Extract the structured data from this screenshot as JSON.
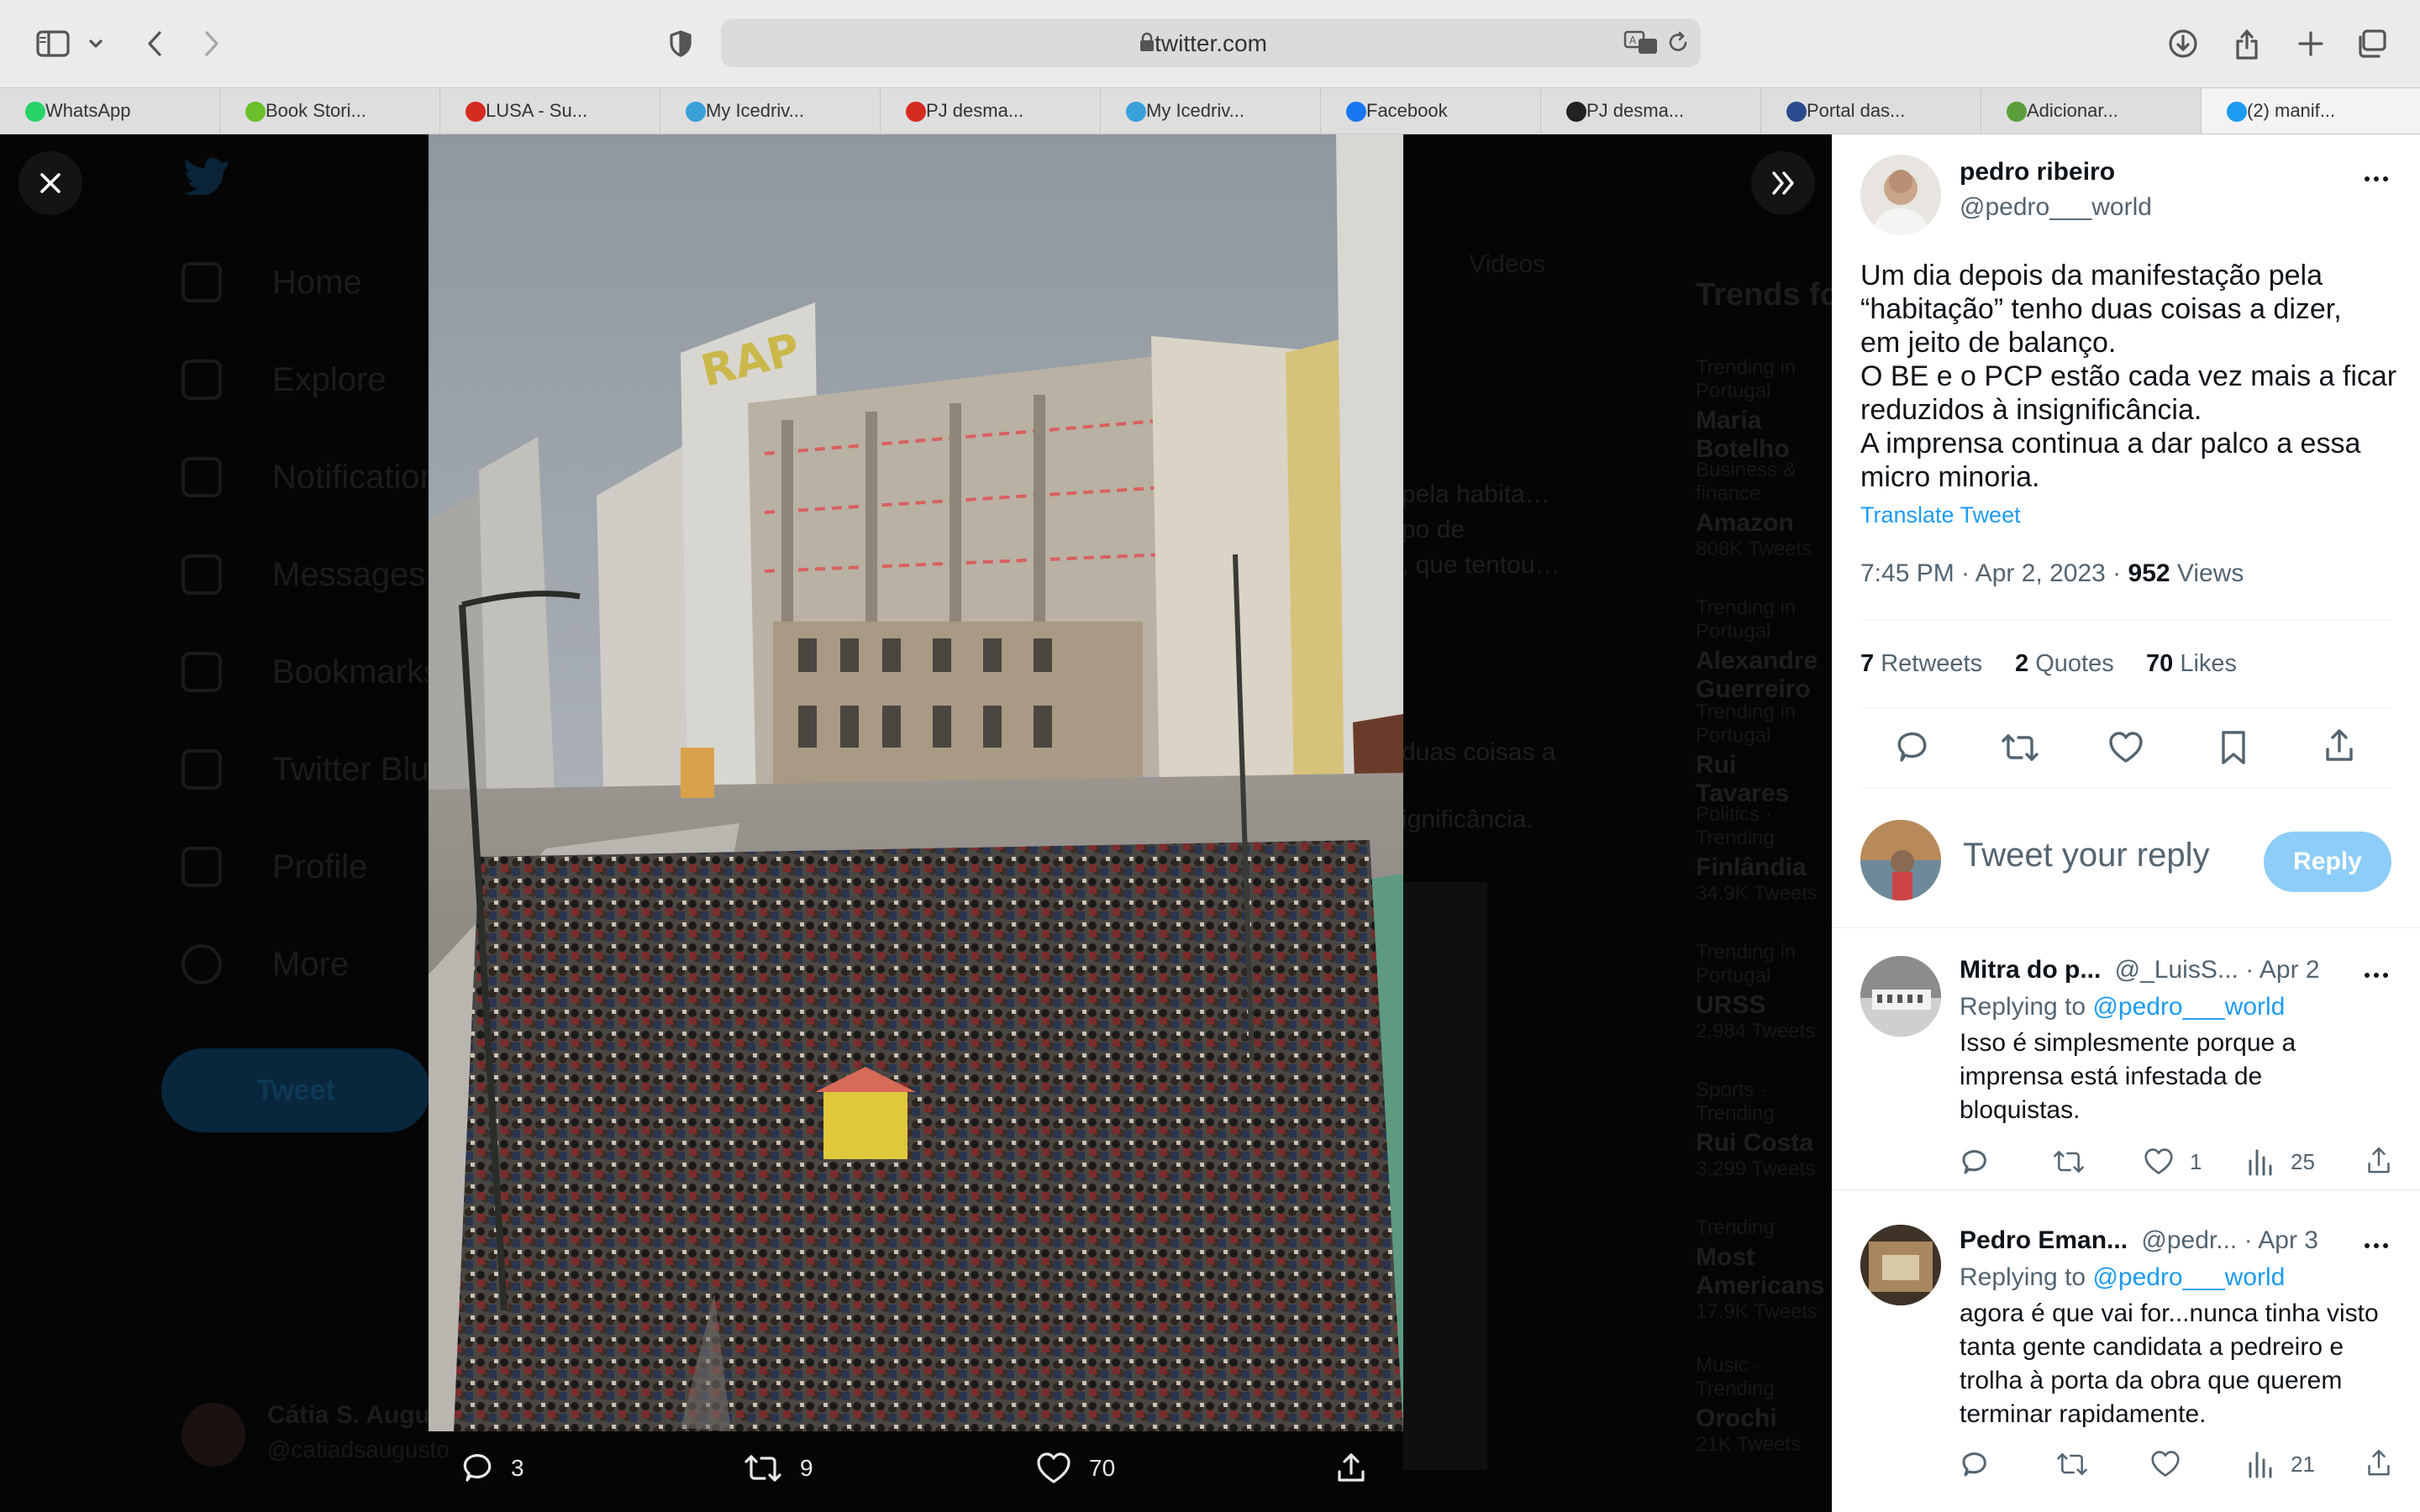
{
  "browser": {
    "url": "twitter.com",
    "tabs": [
      {
        "label": "WhatsApp",
        "favicon": "whatsapp-icon",
        "color": "#25d366"
      },
      {
        "label": "Book Stori...",
        "favicon": "check-icon",
        "color": "#6bbf2a"
      },
      {
        "label": "LUSA - Su...",
        "favicon": "lusa-icon",
        "color": "#d62b1f"
      },
      {
        "label": "My Icedriv...",
        "favicon": "icedrive-icon",
        "color": "#3aa0d8"
      },
      {
        "label": "PJ desma...",
        "favicon": "pj-icon",
        "color": "#d62b1f"
      },
      {
        "label": "My Icedriv...",
        "favicon": "icedrive-icon",
        "color": "#3aa0d8"
      },
      {
        "label": "Facebook",
        "favicon": "facebook-icon",
        "color": "#1877f2"
      },
      {
        "label": "PJ desma...",
        "favicon": "dn-icon",
        "color": "#222222"
      },
      {
        "label": "Portal das...",
        "favicon": "portal-icon",
        "color": "#2a4b8d"
      },
      {
        "label": "Adicionar...",
        "favicon": "notion-icon",
        "color": "#5a9e3a"
      },
      {
        "label": "(2) manif...",
        "favicon": "twitter-icon",
        "color": "#1d9bf0",
        "active": true
      }
    ]
  },
  "background": {
    "nav": [
      "Home",
      "Explore",
      "Notifications",
      "Messages",
      "Bookmarks",
      "Twitter Blue",
      "Profile",
      "More"
    ],
    "tweet_button": "Tweet",
    "videos_tab": "Videos",
    "trends_title": "Trends for you",
    "trends": [
      {
        "meta": "Trending in Portugal",
        "name": "Maria Botelho"
      },
      {
        "meta": "Business & finance",
        "name": "Amazon",
        "count": "808K Tweets"
      },
      {
        "meta": "Trending in Portugal",
        "name": "Alexandre Guerreiro"
      },
      {
        "meta": "Trending in Portugal",
        "name": "Rui Tavares"
      },
      {
        "meta": "Politics · Trending",
        "name": "Finlândia",
        "count": "34.9K Tweets"
      },
      {
        "meta": "Trending in Portugal",
        "name": "URSS",
        "count": "2,984 Tweets"
      },
      {
        "meta": "Sports · Trending",
        "name": "Rui Costa",
        "count": "3,299 Tweets"
      },
      {
        "meta": "Trending",
        "name": "Most Americans",
        "count": "17.9K Tweets"
      },
      {
        "meta": "Music · Trending",
        "name": "Orochi",
        "count": "21K Tweets"
      }
    ],
    "user": {
      "name": "Cátia S. Augusto",
      "handle": "@catiadsaugusto"
    }
  },
  "media": {
    "replies": "3",
    "retweets": "9",
    "likes": "70"
  },
  "tweet": {
    "author": "pedro ribeiro",
    "handle": "@pedro___world",
    "lines": [
      "Um dia depois da manifestação pela",
      "“habitação” tenho duas coisas a dizer,",
      "em jeito de balanço.",
      "O BE e o PCP estão cada vez mais a ficar",
      "reduzidos à insignificância.",
      "A imprensa continua a dar palco a essa",
      "micro minoria."
    ],
    "translate": "Translate Tweet",
    "timestamp": "7:45 PM · Apr 2, 2023 · ",
    "views_count": "952",
    "views_label": " Views",
    "retweets_count": "7",
    "retweets_label": " Retweets",
    "quotes_count": "2",
    "quotes_label": " Quotes",
    "likes_count": "70",
    "likes_label": " Likes"
  },
  "reply_box": {
    "placeholder": "Tweet your reply",
    "button": "Reply"
  },
  "replies": [
    {
      "name": "Mitra do p...",
      "handle": "@_LuisS...",
      "date": "· Apr 2",
      "replying_prefix": "Replying to ",
      "replying_to": "@pedro___world",
      "lines": [
        "Isso é simplesmente porque a",
        "imprensa está infestada de",
        "bloquistas."
      ],
      "likes": "1",
      "views": "25"
    },
    {
      "name": "Pedro Eman...",
      "handle": "@pedr...",
      "date": "· Apr 3",
      "replying_prefix": "Replying to ",
      "replying_to": "@pedro___world",
      "lines": [
        "agora é que vai for...nunca tinha visto",
        "tanta gente candidata a pedreiro e",
        "trolha à porta da obra que querem",
        "terminar rapidamente."
      ],
      "likes": "",
      "views": "21"
    }
  ]
}
